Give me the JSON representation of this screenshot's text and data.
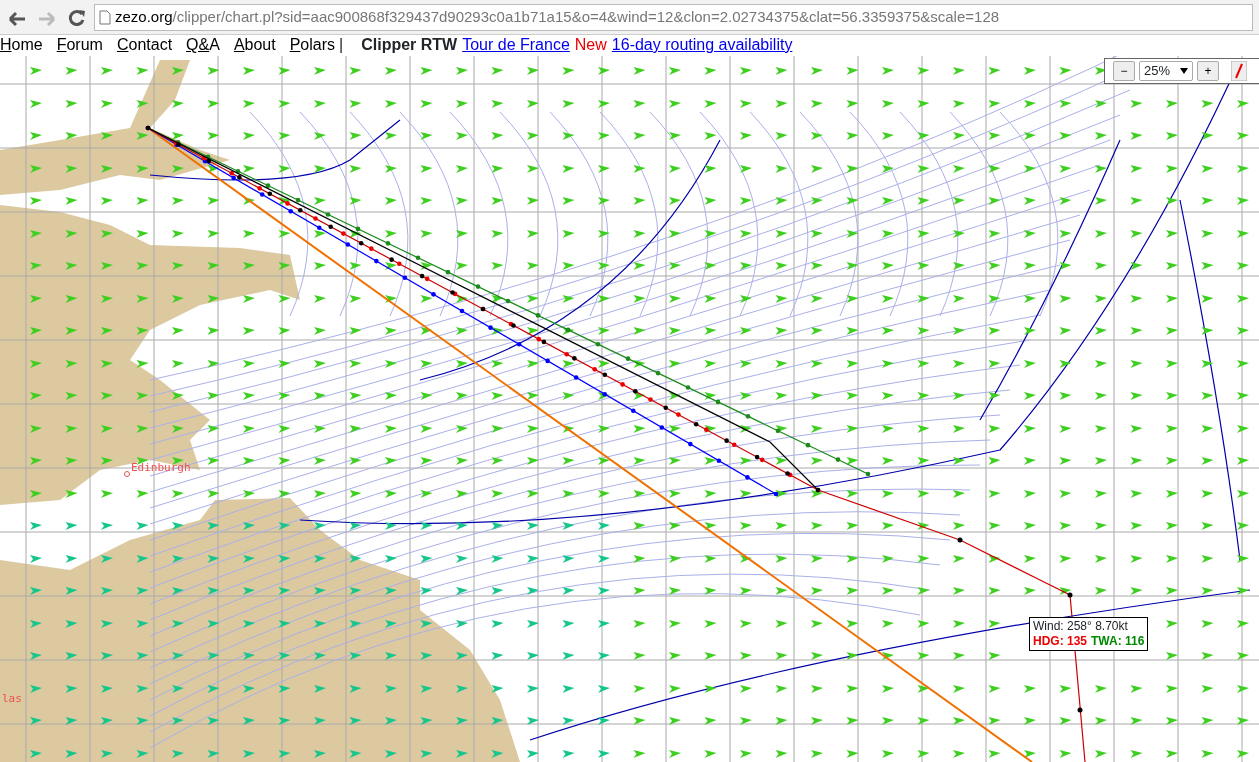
{
  "browser": {
    "url_host": "zezo.org",
    "url_path": "/clipper/chart.pl?sid=aac900868f329437d90293c0a1b71a15&o=4&wind=12&clon=2.02734375&clat=56.3359375&scale=128"
  },
  "menu": [
    {
      "label": "Home"
    },
    {
      "label": "Forum"
    },
    {
      "label": "Contact"
    },
    {
      "label": "Q&A"
    },
    {
      "label": "About"
    },
    {
      "label": "Polars"
    }
  ],
  "separator": "|",
  "brand": "Clipper RTW",
  "links": [
    {
      "label": "Tour de France",
      "kind": "link"
    },
    {
      "label": "New",
      "kind": "flag"
    },
    {
      "label": "16-day routing availability",
      "kind": "link"
    }
  ],
  "zoom": {
    "minus": "−",
    "value": "25%",
    "plus": "+"
  },
  "map": {
    "places": [
      {
        "name": "Edinburgh"
      },
      {
        "name": "las"
      }
    ],
    "tooltip": {
      "wind": "Wind: 258° 8.70kt",
      "hdg": "HDG: 135",
      "twa": "TWA: 116"
    }
  }
}
